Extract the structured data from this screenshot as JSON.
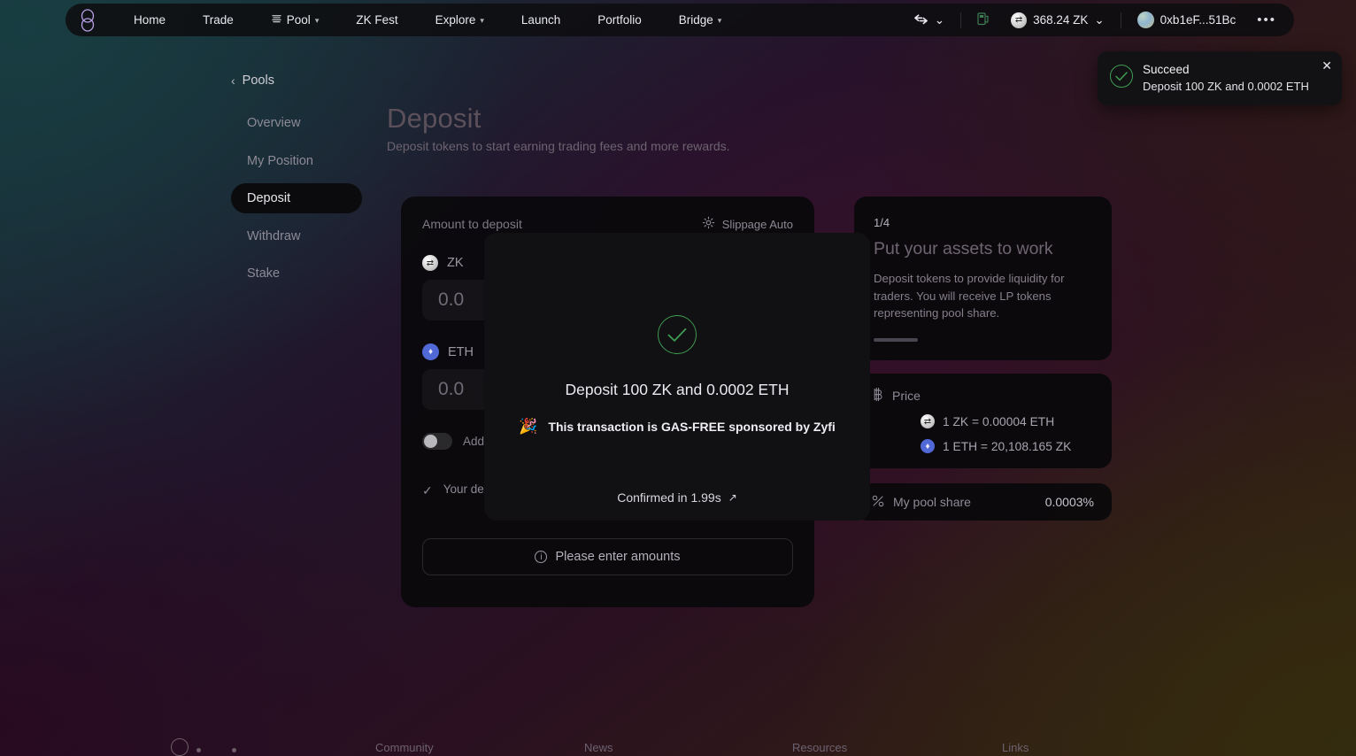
{
  "nav": {
    "logo_icon": "zklink-infinity-logo",
    "items": [
      {
        "label": "Home",
        "icon": null,
        "caret": false
      },
      {
        "label": "Trade",
        "icon": null,
        "caret": false
      },
      {
        "label": "Pool",
        "icon": "pool-stack-icon",
        "caret": true
      },
      {
        "label": "ZK Fest",
        "icon": null,
        "caret": false
      },
      {
        "label": "Explore",
        "icon": null,
        "caret": true
      },
      {
        "label": "Launch",
        "icon": null,
        "caret": false
      },
      {
        "label": "Portfolio",
        "icon": null,
        "caret": false
      },
      {
        "label": "Bridge",
        "icon": null,
        "caret": true
      }
    ],
    "swap_icon": "swap-arrows-icon",
    "swap_caret": "⌄",
    "gas_icon": "gas-pump-icon",
    "balance": "368.24 ZK",
    "balance_caret": "⌄",
    "account": "0xb1eF...51Bc",
    "more_icon": "more-dots-icon",
    "more_label": "•••"
  },
  "toast": {
    "icon": "success-check-circle-icon",
    "title": "Succeed",
    "message": "Deposit 100 ZK and 0.0002 ETH",
    "close_label": "✕"
  },
  "breadcrumb": {
    "arrow": "‹",
    "label": "Pools"
  },
  "sidebar": {
    "items": [
      {
        "label": "Overview",
        "active": false
      },
      {
        "label": "My Position",
        "active": false
      },
      {
        "label": "Deposit",
        "active": true
      },
      {
        "label": "Withdraw",
        "active": false
      },
      {
        "label": "Stake",
        "active": false
      }
    ]
  },
  "page": {
    "title": "Deposit",
    "subtitle": "Deposit tokens to start earning trading fees and more rewards."
  },
  "deposit_card": {
    "heading": "Amount to deposit",
    "slippage_icon": "gear-icon",
    "slippage_label": "Slippage Auto",
    "token_a": {
      "symbol": "ZK",
      "icon": "zk-token-icon",
      "value": "",
      "placeholder": "0.0"
    },
    "token_b": {
      "symbol": "ETH",
      "icon": "eth-token-icon",
      "value": "",
      "placeholder": "0.0"
    },
    "toggle_label": "Add liquidity",
    "note_icon": "check-icon",
    "note_text": "Your deposit will start earning trading fees automatically.",
    "cta_icon": "info-icon",
    "cta_label": "Please enter amounts"
  },
  "tip_card": {
    "step": "1/4",
    "title": "Put your assets to work",
    "body": "Deposit tokens to provide liquidity for traders. You will receive LP tokens representing pool share."
  },
  "price_card": {
    "icon": "price-tag-icon",
    "label": "Price",
    "rates": [
      {
        "icon": "zk-token-icon",
        "text": "1 ZK = 0.00004 ETH"
      },
      {
        "icon": "eth-token-icon",
        "text": "1 ETH = 20,108.165 ZK"
      }
    ]
  },
  "pool_share_card": {
    "icon": "percent-icon",
    "label": "My pool share",
    "value": "0.0003%"
  },
  "modal": {
    "icon": "success-check-circle-icon",
    "title": "Deposit 100 ZK and 0.0002 ETH",
    "gas_icon": "party-popper-icon",
    "gas_text": "This transaction is GAS-FREE sponsored by Zyfi",
    "confirmed_label": "Confirmed in 1.99s",
    "confirmed_icon": "external-link-icon"
  },
  "footer": {
    "logo_icon": "brand-mark-icon",
    "columns": [
      "Community",
      "News",
      "Resources",
      "Links"
    ]
  },
  "colors": {
    "accent_green": "#3f9b52",
    "eth_blue": "#5069d6",
    "active_bg": "#0b0b0d",
    "card_bg": "#0a090b"
  }
}
